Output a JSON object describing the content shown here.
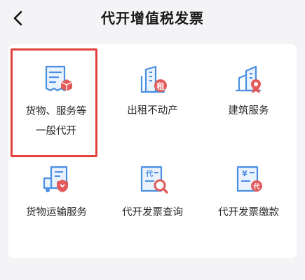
{
  "header": {
    "title": "代开增值税发票",
    "back_icon": "chevron-left-icon"
  },
  "services": [
    {
      "label": "货物、服务等一般代开",
      "icon": "invoice-with-box-icon",
      "selected": true
    },
    {
      "label": "出租不动产",
      "icon": "building-rent-icon",
      "selected": false
    },
    {
      "label": "建筑服务",
      "icon": "construction-service-icon",
      "selected": false
    },
    {
      "label": "货物运输服务",
      "icon": "truck-shield-icon",
      "selected": false
    },
    {
      "label": "代开发票查询",
      "icon": "invoice-search-icon",
      "selected": false
    },
    {
      "label": "代开发票缴款",
      "icon": "invoice-payment-icon",
      "selected": false
    }
  ],
  "colors": {
    "icon_blue": "#4a8fe2",
    "icon_red": "#e25a5a",
    "highlight": "#e2413d",
    "panel": "#ffffff",
    "background": "#f4f4f6"
  }
}
